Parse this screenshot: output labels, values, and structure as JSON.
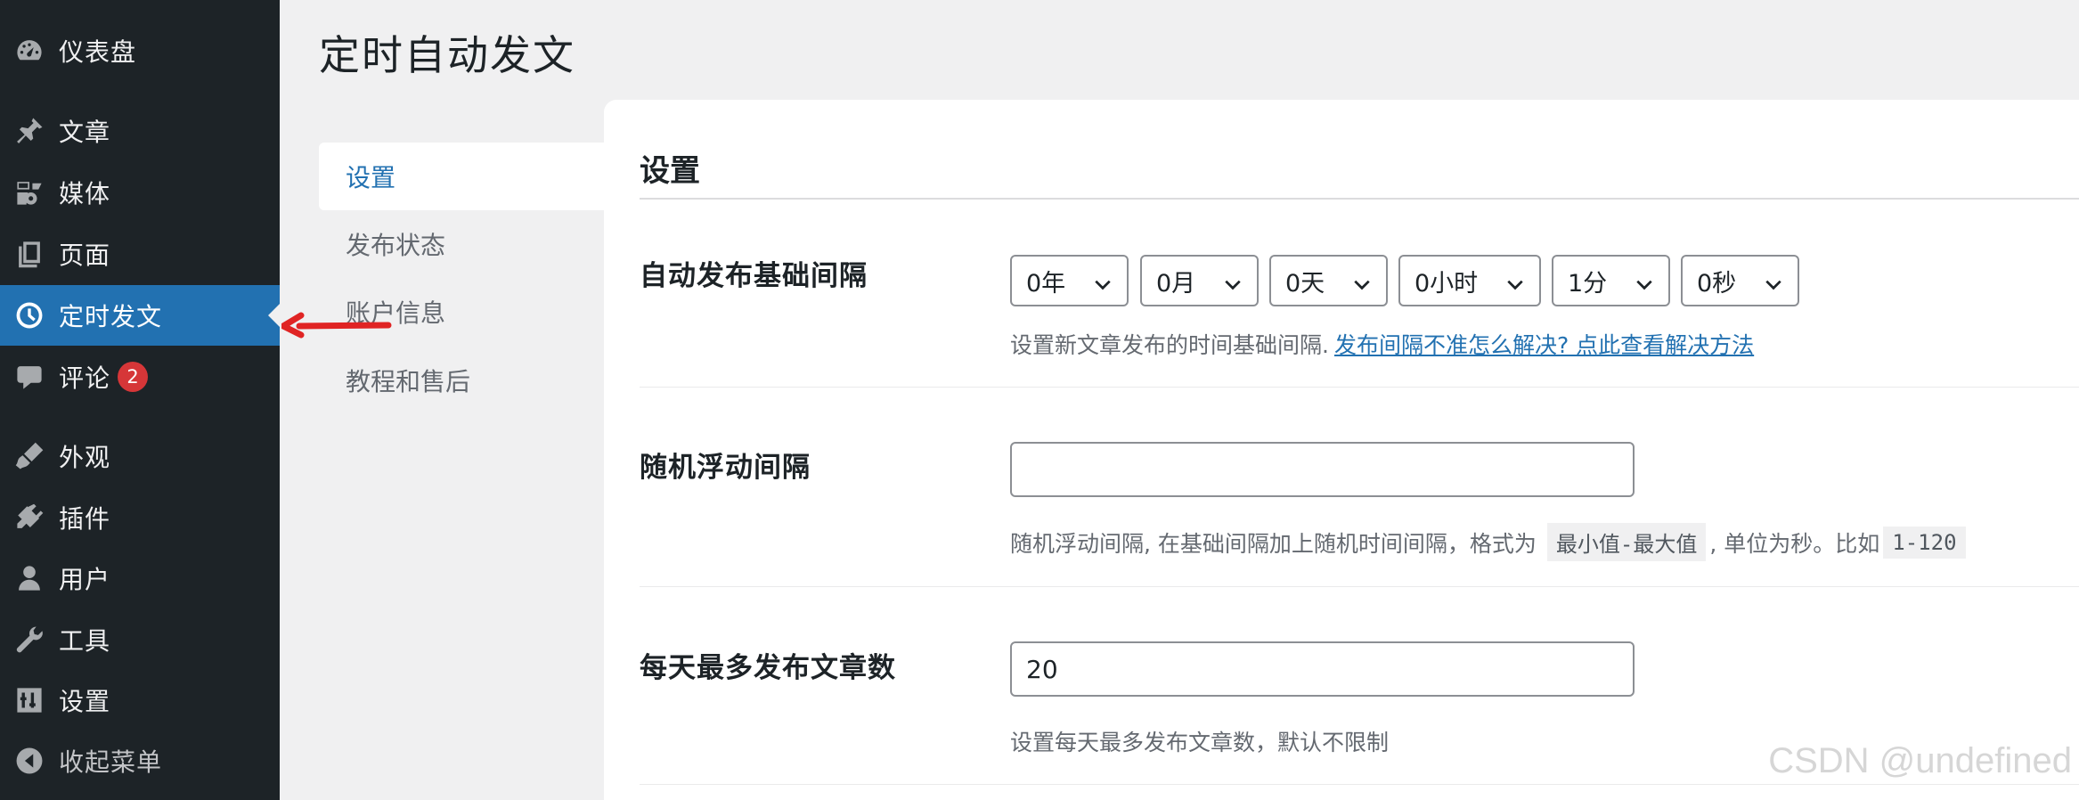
{
  "sidebar": {
    "items": [
      {
        "label": "仪表盘",
        "icon": "dashboard-icon"
      },
      {
        "label": "文章",
        "icon": "pin-icon"
      },
      {
        "label": "媒体",
        "icon": "media-icon"
      },
      {
        "label": "页面",
        "icon": "page-icon"
      },
      {
        "label": "定时发文",
        "icon": "clock-icon",
        "active": true
      },
      {
        "label": "评论",
        "icon": "comment-icon",
        "badge": "2"
      },
      {
        "label": "外观",
        "icon": "brush-icon"
      },
      {
        "label": "插件",
        "icon": "plugin-icon"
      },
      {
        "label": "用户",
        "icon": "user-icon"
      },
      {
        "label": "工具",
        "icon": "wrench-icon"
      },
      {
        "label": "设置",
        "icon": "settings-icon"
      },
      {
        "label": "收起菜单",
        "icon": "collapse-icon"
      }
    ]
  },
  "page": {
    "title": "定时自动发文"
  },
  "subnav": {
    "items": [
      {
        "label": "设置",
        "active": true
      },
      {
        "label": "发布状态"
      },
      {
        "label": "账户信息"
      },
      {
        "label": "教程和售后"
      }
    ]
  },
  "settings": {
    "section_title": "设置",
    "interval": {
      "label": "自动发布基础间隔",
      "selects": [
        "0年",
        "0月",
        "0天",
        "0小时",
        "1分",
        "0秒"
      ],
      "desc": "设置新文章发布的时间基础间隔.",
      "link": "发布间隔不准怎么解决? 点此查看解决方法"
    },
    "random": {
      "label": "随机浮动间隔",
      "value": "",
      "desc_a": "随机浮动间隔, 在基础间隔加上随机时间间隔，格式为",
      "code_a": "最小值-最大值",
      "desc_b": ", 单位为秒。比如",
      "code_b": "1-120"
    },
    "daily": {
      "label": "每天最多发布文章数",
      "value": "20",
      "desc": "设置每天最多发布文章数，默认不限制"
    }
  },
  "watermark": "CSDN @undefined",
  "colors": {
    "accent": "#2271b1",
    "sidebar": "#1d2327",
    "badge": "#d63638",
    "annotation": "#e02424"
  }
}
